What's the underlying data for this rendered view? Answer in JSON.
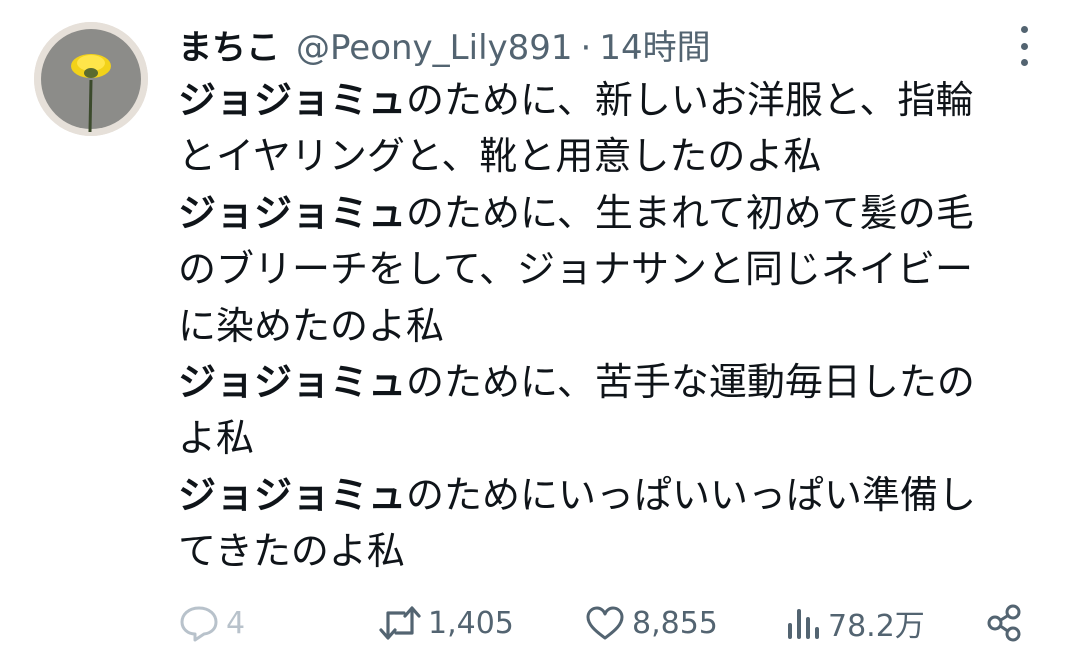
{
  "tweet": {
    "author_name": "まちこ",
    "handle": "@Peony_Lily891",
    "separator": "·",
    "time": "14時間",
    "lines": [
      {
        "bold": "ジョジョミュ",
        "text": "のために、新しいお洋服と、指輪"
      },
      {
        "bold": "",
        "text": "とイヤリングと、靴と用意したのよ私"
      },
      {
        "bold": "ジョジョミュ",
        "text": "のために、生まれて初めて髪の毛"
      },
      {
        "bold": "",
        "text": "のブリーチをして、ジョナサンと同じネイビー"
      },
      {
        "bold": "",
        "text": "に染めたのよ私"
      },
      {
        "bold": "ジョジョミュ",
        "text": "のために、苦手な運動毎日したの"
      },
      {
        "bold": "",
        "text": "よ私"
      },
      {
        "bold": "ジョジョミュ",
        "text": "のためにいっぱいいっぱい準備し"
      },
      {
        "bold": "",
        "text": "てきたのよ私"
      }
    ]
  },
  "actions": {
    "reply_count": "4",
    "retweet_count": "1,405",
    "like_count": "8,855",
    "views_count": "78.2万"
  },
  "icons": {
    "avatar": "yellow-flower-avatar",
    "more": "more-vertical-icon",
    "reply": "reply-icon",
    "retweet": "retweet-icon",
    "like": "heart-icon",
    "views": "views-icon",
    "share": "share-icon"
  },
  "colors": {
    "text_primary": "#0f1419",
    "text_secondary": "#536471",
    "reply_faded": "#b8c2cb",
    "flower": "#f2d21a"
  }
}
